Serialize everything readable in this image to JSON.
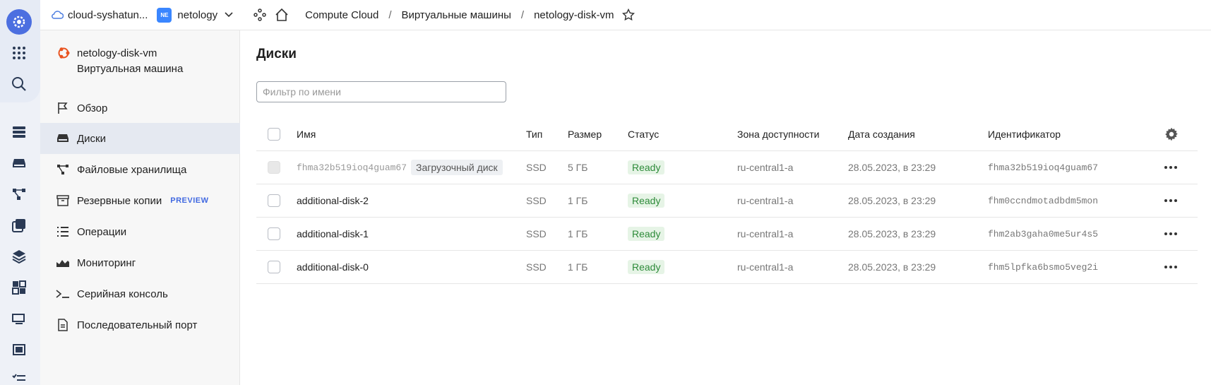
{
  "header": {
    "cloud_name": "cloud-syshatun...",
    "folder_badge": "NE",
    "folder_name": "netology",
    "breadcrumbs": [
      "Compute Cloud",
      "Виртуальные машины",
      "netology-disk-vm"
    ]
  },
  "sidebar": {
    "vm_name": "netology-disk-vm",
    "vm_type": "Виртуальная машина",
    "items": [
      {
        "label": "Обзор",
        "icon": "flag-icon"
      },
      {
        "label": "Диски",
        "icon": "disk-icon",
        "active": true
      },
      {
        "label": "Файловые хранилища",
        "icon": "network-icon"
      },
      {
        "label": "Резервные копии",
        "icon": "archive-icon",
        "badge": "PREVIEW"
      },
      {
        "label": "Операции",
        "icon": "list-icon"
      },
      {
        "label": "Мониторинг",
        "icon": "chart-icon"
      },
      {
        "label": "Серийная консоль",
        "icon": "terminal-icon"
      },
      {
        "label": "Последовательный порт",
        "icon": "document-icon"
      }
    ]
  },
  "main": {
    "title": "Диски",
    "filter_placeholder": "Фильтр по имени",
    "columns": [
      "Имя",
      "Тип",
      "Размер",
      "Статус",
      "Зона доступности",
      "Дата создания",
      "Идентификатор"
    ],
    "rows": [
      {
        "name": "fhma32b519ioq4guam67",
        "tag": "Загрузочный диск",
        "type": "SSD",
        "size": "5 ГБ",
        "status": "Ready",
        "zone": "ru-central1-a",
        "created": "28.05.2023, в 23:29",
        "id": "fhma32b519ioq4guam67"
      },
      {
        "name": "additional-disk-2",
        "type": "SSD",
        "size": "1 ГБ",
        "status": "Ready",
        "zone": "ru-central1-a",
        "created": "28.05.2023, в 23:29",
        "id": "fhm0ccndmotadbdm5mon"
      },
      {
        "name": "additional-disk-1",
        "type": "SSD",
        "size": "1 ГБ",
        "status": "Ready",
        "zone": "ru-central1-a",
        "created": "28.05.2023, в 23:29",
        "id": "fhm2ab3gaha0me5ur4s5"
      },
      {
        "name": "additional-disk-0",
        "type": "SSD",
        "size": "1 ГБ",
        "status": "Ready",
        "zone": "ru-central1-a",
        "created": "28.05.2023, в 23:29",
        "id": "fhm5lpfka6bsmo5veg2i"
      }
    ]
  }
}
